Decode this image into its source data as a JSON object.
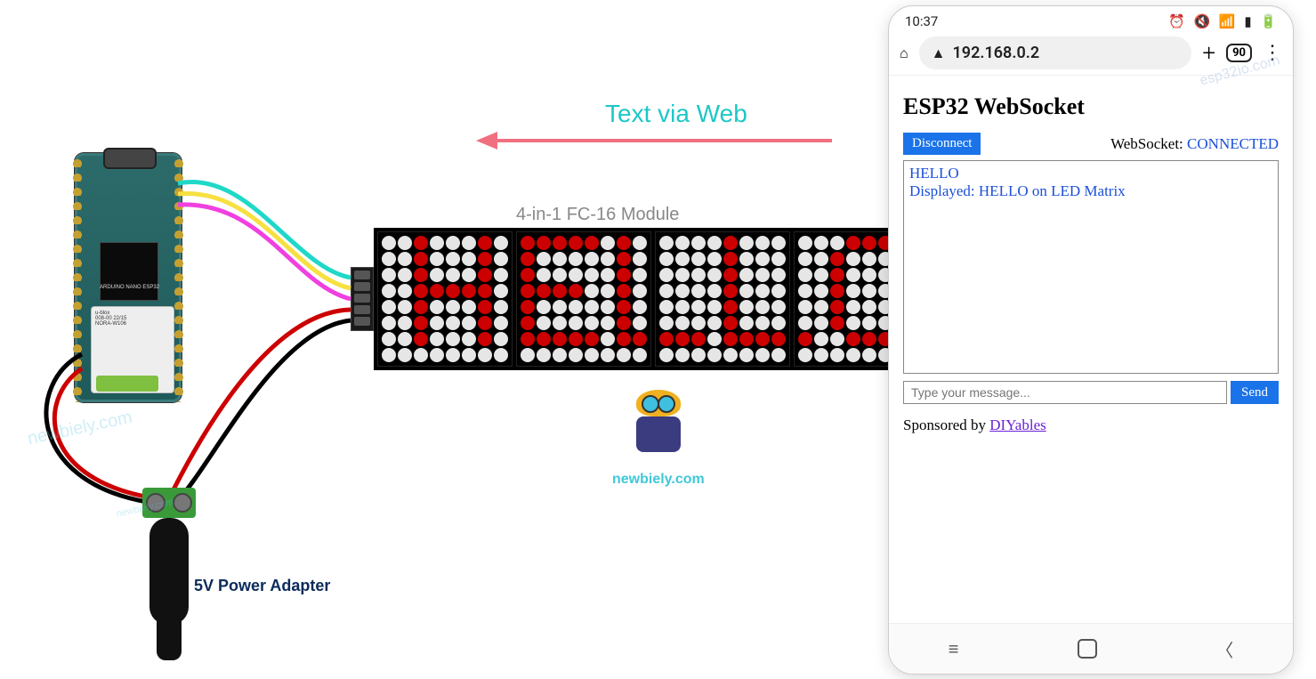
{
  "diagram": {
    "arrow_label": "Text via Web",
    "matrix_label": "4-in-1 FC-16 Module",
    "power_label": "5V Power Adapter",
    "logo_text": "newbiely.com",
    "watermark1": "newbiely.com",
    "watermark2": "esp32io.com",
    "board": {
      "name": "ARDUINO",
      "variant": "NANO ESP32",
      "module_id": "008-00 22/15",
      "module_name": "NORA-W106",
      "chip_vendor": "u-blox"
    }
  },
  "phone": {
    "status": {
      "time": "10:37",
      "tabs_count": "90"
    },
    "address": "192.168.0.2",
    "page": {
      "title": "ESP32 WebSocket",
      "disconnect_label": "Disconnect",
      "ws_label": "WebSocket:",
      "ws_state": "CONNECTED",
      "log_line1": "HELLO",
      "log_line2": "Displayed: HELLO on LED Matrix",
      "input_placeholder": "Type your message...",
      "send_label": "Send",
      "sponsor_prefix": "Sponsored by ",
      "sponsor_link": "DIYables"
    }
  },
  "matrix_text": "HELLO"
}
